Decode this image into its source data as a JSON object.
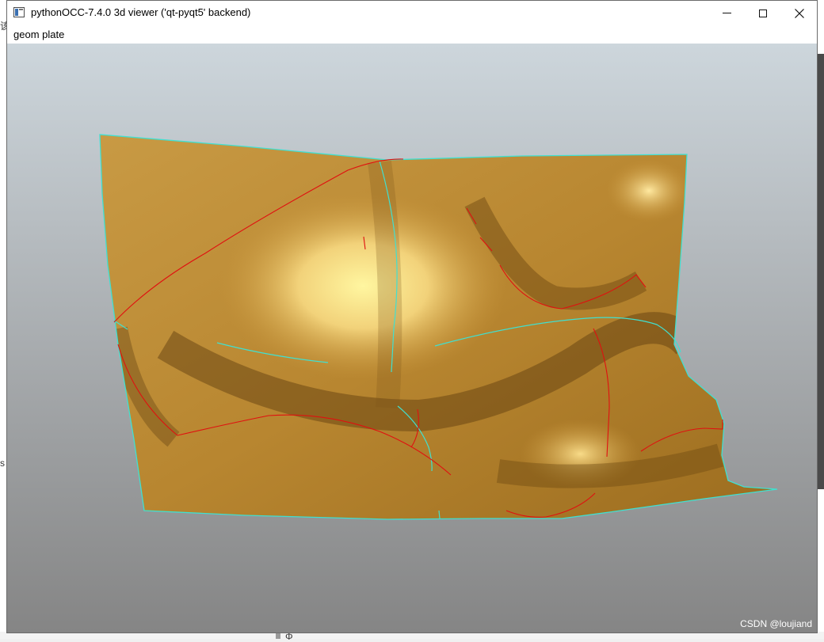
{
  "window": {
    "title": "pythonOCC-7.4.0 3d viewer ('qt-pyqt5' backend)",
    "menu": [
      {
        "prefix": "g",
        "rest": "eom plate"
      }
    ]
  },
  "viewport": {
    "background_top": "#cdd6dc",
    "background_bottom": "#858585",
    "surface_color": "#c8963c",
    "edge_color": "#40e0d0",
    "curve_color": "#e01010"
  },
  "watermark": "CSDN @loujiand",
  "desktop": {
    "side_text_top": "该",
    "side_text_mid": "s",
    "bottom_symbol": "Φ"
  }
}
